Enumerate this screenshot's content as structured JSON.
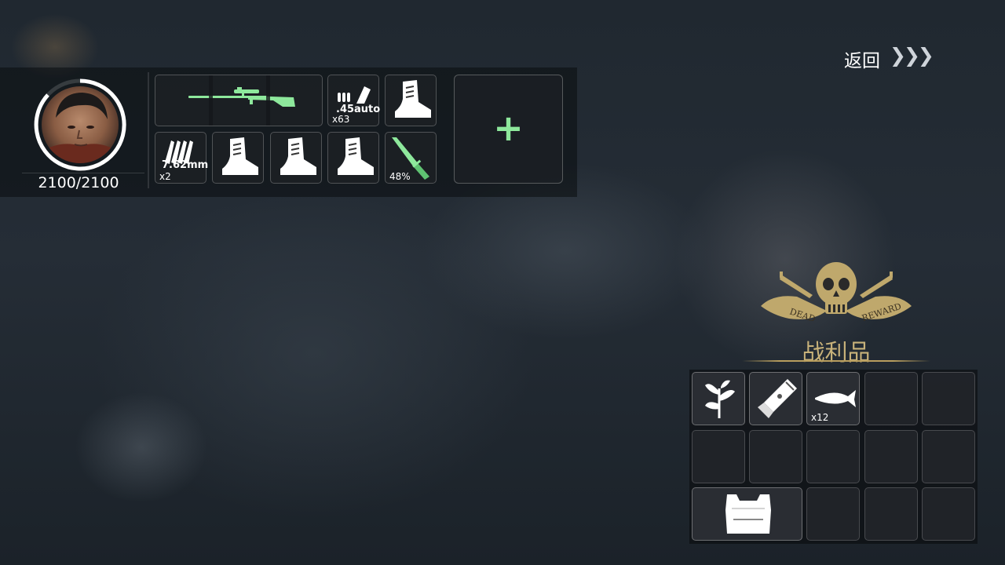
{
  "player": {
    "hp": "2100/2100"
  },
  "header": {
    "back_label": "返回",
    "back_arrows": "❯❯❯"
  },
  "equipment": {
    "primary_weapon": "sniper-rifle-icon",
    "ammo_45": {
      "label": ".45auto",
      "qty": "x63"
    },
    "ammo_762": {
      "label": "7.62mm",
      "qty": "x2"
    },
    "knife": {
      "durability": "48%"
    },
    "add_label": "+"
  },
  "loot": {
    "title": "战利品",
    "emblem_text_left": "DEAD",
    "emblem_text_right": "REWARD",
    "items": [
      {
        "icon": "herb-icon",
        "qty": ""
      },
      {
        "icon": "flashlight-icon",
        "qty": ""
      },
      {
        "icon": "fish-icon",
        "qty": "x12"
      },
      {
        "icon": "body-armor-icon",
        "qty": ""
      }
    ]
  },
  "colors": {
    "accent_green": "#8ee89c",
    "gold": "#c8b27a"
  }
}
